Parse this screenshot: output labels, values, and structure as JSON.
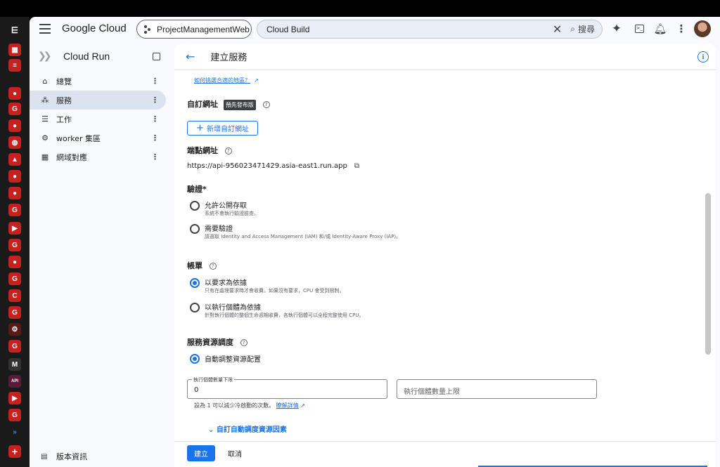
{
  "topbar": {
    "logo": "Google Cloud",
    "project": "ProjectManagementWeb",
    "search_value": "Cloud Build",
    "search_button": "搜尋",
    "icons": [
      "menu-icon",
      "sparkle-icon",
      "terminal-icon",
      "bell-icon",
      "more-vert-icon"
    ]
  },
  "sidebar": {
    "product": "Cloud Run",
    "items": [
      {
        "label": "總覽",
        "icon": "home-icon"
      },
      {
        "label": "服務",
        "icon": "services-icon"
      },
      {
        "label": "工作",
        "icon": "list-icon"
      },
      {
        "label": "worker 集區",
        "icon": "cogs-icon"
      },
      {
        "label": "網域對應",
        "icon": "domain-icon"
      }
    ],
    "release_notes": "版本資訊"
  },
  "header": {
    "title": "建立服務"
  },
  "content": {
    "region_link": "如何挑選合適的地區？",
    "custom_url_title": "自訂網址",
    "preview_badge": "預先發布版",
    "add_url_button": "新增自訂網址",
    "endpoint_title": "端點網址",
    "endpoint_url": "https://api-956023471429.asia-east1.run.app",
    "auth_title": "驗證*",
    "auth_options": [
      {
        "label": "允許公開存取",
        "desc": "系統不會執行驗證檢查。",
        "selected": false
      },
      {
        "label": "需要驗證",
        "desc": "請選取 Identity and Access Management (IAM) 和/或 Identity-Aware Proxy (IAP)。",
        "selected": false
      }
    ],
    "billing_title": "帳單",
    "billing_options": [
      {
        "label": "以要求為依據",
        "desc": "只有在處理要求時才會收費。如果沒有要求，CPU 會受到限制。",
        "selected": true
      },
      {
        "label": "以執行個體為依據",
        "desc": "針對執行個體的整個生命週期收費，各執行個體可以全程完整使用 CPU。",
        "selected": false
      }
    ],
    "scaling_title": "服務資源調度",
    "scaling_option": "自動調整資源配置",
    "min_instances_label": "執行個體數量下限",
    "min_instances_value": "0",
    "max_instances_placeholder": "執行個體數量上限",
    "hint_text": "設為 1 可以減少冷啟動的次數。",
    "learn_more": "瞭解詳情",
    "expand_label": "自訂自動調度資源因素"
  },
  "footer": {
    "create": "建立",
    "cancel": "取消"
  },
  "colors": {
    "accent": "#1a73e8",
    "active_nav": "#dbe3f0"
  }
}
